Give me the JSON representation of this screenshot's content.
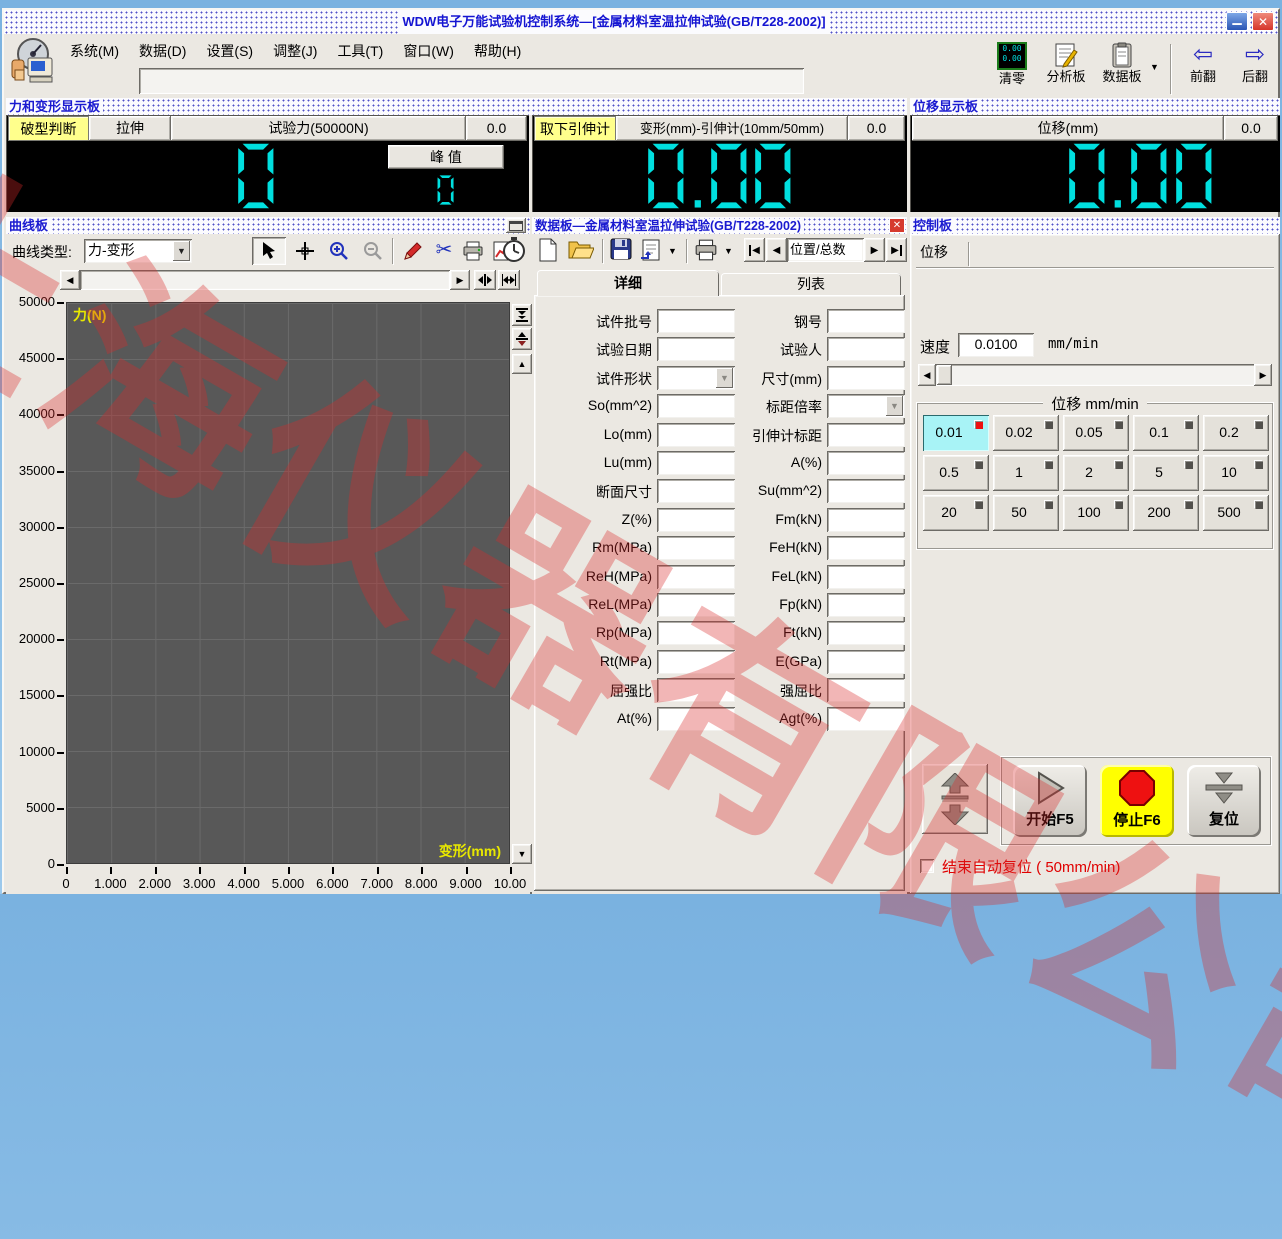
{
  "window": {
    "title": "WDW电子万能试验机控制系统—[金属材料室温拉伸试验(GB/T228-2002)]"
  },
  "menu": {
    "items": [
      "系统(M)",
      "数据(D)",
      "设置(S)",
      "调整(J)",
      "工具(T)",
      "窗口(W)",
      "帮助(H)"
    ]
  },
  "toolbar": {
    "clear": "清零",
    "analysis": "分析板",
    "databoard": "数据板",
    "prev": "前翻",
    "next": "后翻"
  },
  "glyphs": {
    "prev_arrow": "⇦",
    "next_arrow": "⇨",
    "left": "◀",
    "right": "▶",
    "up": "▲",
    "down": "▼",
    "scissors": "✂",
    "dropdown": "▼",
    "close": "✕",
    "minimize": "▁"
  },
  "force_panel": {
    "title": "力和变形显示板",
    "break_btn": "破型判断",
    "tensile_btn": "拉伸",
    "force_header": "试验力(50000N)",
    "force_value": "0.0",
    "force_display": "0",
    "peak_btn": "峰 值",
    "peak_display": "0",
    "extensometer_btn": "取下引伸计",
    "deform_header": "变形(mm)-引伸计(10mm/50mm)",
    "deform_value": "0.0",
    "deform_display": "0.00"
  },
  "displacement_panel": {
    "title": "位移显示板",
    "header": "位移(mm)",
    "value": "0.0",
    "display": "0.00"
  },
  "curve_panel": {
    "title": "曲线板",
    "type_label": "曲线类型:",
    "type_value": "力-变形"
  },
  "chart_data": {
    "type": "line",
    "title": "",
    "xlabel": "变形(mm)",
    "ylabel": "力(N)",
    "xlim": [
      0,
      10
    ],
    "ylim": [
      0,
      50000
    ],
    "x_tick_labels": [
      "0",
      "1.000",
      "2.000",
      "3.000",
      "4.000",
      "5.000",
      "6.000",
      "7.000",
      "8.000",
      "9.000",
      "10.00"
    ],
    "y_tick_labels": [
      "50000",
      "45000",
      "40000",
      "35000",
      "30000",
      "25000",
      "20000",
      "15000",
      "10000",
      "5000",
      "0"
    ],
    "grid": true,
    "legend": false,
    "series": []
  },
  "data_panel": {
    "title": "数据板—金属材料室温拉伸试验(GB/T228-2002)",
    "nav_box": "位置/总数",
    "tabs": [
      "详细",
      "列表"
    ],
    "rows": [
      {
        "l": {
          "label": "试件批号",
          "type": "input"
        },
        "r": {
          "label": "钢号",
          "type": "input"
        }
      },
      {
        "l": {
          "label": "试验日期",
          "type": "input"
        },
        "r": {
          "label": "试验人",
          "type": "input"
        }
      },
      {
        "l": {
          "label": "试件形状",
          "type": "combo"
        },
        "r": {
          "label": "尺寸(mm)",
          "type": "input"
        }
      },
      {
        "l": {
          "label": "So(mm^2)",
          "type": "input"
        },
        "r": {
          "label": "标距倍率",
          "type": "combo"
        }
      },
      {
        "l": {
          "label": "Lo(mm)",
          "type": "input"
        },
        "r": {
          "label": "引伸计标距",
          "type": "input"
        }
      },
      {
        "l": {
          "label": "Lu(mm)",
          "type": "input"
        },
        "r": {
          "label": "A(%)",
          "type": "input"
        }
      },
      {
        "l": {
          "label": "断面尺寸",
          "type": "input"
        },
        "r": {
          "label": "Su(mm^2)",
          "type": "input"
        }
      },
      {
        "l": {
          "label": "Z(%)",
          "type": "input"
        },
        "r": {
          "label": "Fm(kN)",
          "type": "input"
        }
      },
      {
        "l": {
          "label": "Rm(MPa)",
          "type": "input"
        },
        "r": {
          "label": "FeH(kN)",
          "type": "input"
        }
      },
      {
        "l": {
          "label": "ReH(MPa)",
          "type": "input"
        },
        "r": {
          "label": "FeL(kN)",
          "type": "input"
        }
      },
      {
        "l": {
          "label": "ReL(MPa)",
          "type": "input"
        },
        "r": {
          "label": "Fp(kN)",
          "type": "input"
        }
      },
      {
        "l": {
          "label": "Rp(MPa)",
          "type": "input"
        },
        "r": {
          "label": "Ft(kN)",
          "type": "input"
        }
      },
      {
        "l": {
          "label": "Rt(MPa)",
          "type": "input"
        },
        "r": {
          "label": "E(GPa)",
          "type": "input"
        }
      },
      {
        "l": {
          "label": "屈强比",
          "type": "input"
        },
        "r": {
          "label": "强屈比",
          "type": "input"
        }
      },
      {
        "l": {
          "label": "At(%)",
          "type": "input"
        },
        "r": {
          "label": "Agt(%)",
          "type": "input"
        }
      }
    ]
  },
  "control_panel": {
    "title": "控制板",
    "tab": "位移",
    "speed_label": "速度",
    "speed_value": "0.0100",
    "speed_unit": "mm/min",
    "group_title": "位移 mm/min",
    "speeds": [
      "0.01",
      "0.02",
      "0.05",
      "0.1",
      "0.2",
      "0.5",
      "1",
      "2",
      "5",
      "10",
      "20",
      "50",
      "100",
      "200",
      "500"
    ],
    "selected_speed": "0.01",
    "start_btn": "开始F5",
    "stop_btn": "停止F6",
    "reset_btn": "复位",
    "auto_reset": "结束自动复位 ( 50mm/min)"
  },
  "watermark": {
    "text": "上海仪器有限公司"
  },
  "colors": {
    "display_digits": "#00dfdf",
    "header_text": "#1a1ad0",
    "selected_speed_bg": "#a8f3f6",
    "stop_bg": "#ffff00",
    "warning_text": "#e00000",
    "plot_bg": "#585858",
    "plot_grid": "#6a6a6a",
    "axis_label": "#e8e800",
    "highlight_yellow": "#ffff8c"
  }
}
